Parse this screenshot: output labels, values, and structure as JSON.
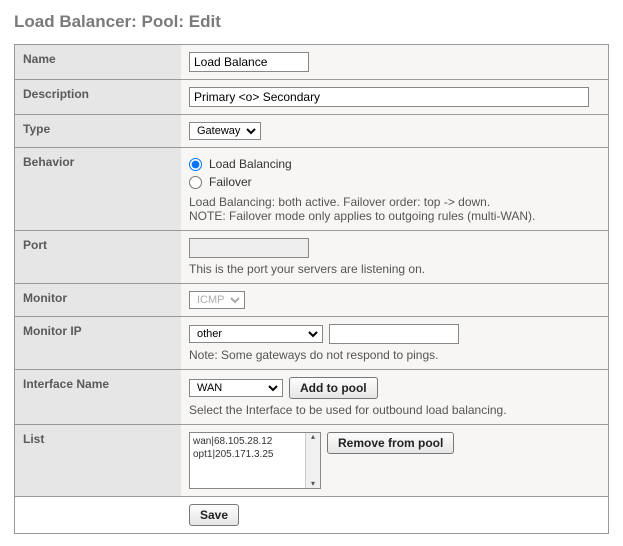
{
  "page_title": "Load Balancer: Pool: Edit",
  "rows": {
    "name": {
      "label": "Name",
      "value": "Load Balance"
    },
    "description": {
      "label": "Description",
      "value": "Primary <o> Secondary"
    },
    "type": {
      "label": "Type",
      "selected": "Gateway",
      "options": [
        "Gateway"
      ]
    },
    "behavior": {
      "label": "Behavior",
      "options": {
        "load_balancing": {
          "label": "Load Balancing",
          "checked": true
        },
        "failover": {
          "label": "Failover",
          "checked": false
        }
      },
      "help1": "Load Balancing: both active. Failover order: top -> down.",
      "help2": "NOTE: Failover mode only applies to outgoing rules (multi-WAN)."
    },
    "port": {
      "label": "Port",
      "value": "",
      "help": "This is the port your servers are listening on."
    },
    "monitor": {
      "label": "Monitor",
      "selected": "ICMP",
      "options": [
        "ICMP"
      ]
    },
    "monitor_ip": {
      "label": "Monitor IP",
      "selected": "other",
      "options": [
        "other"
      ],
      "value": "",
      "help": "Note: Some gateways do not respond to pings."
    },
    "interface_name": {
      "label": "Interface Name",
      "selected": "WAN",
      "options": [
        "WAN"
      ],
      "add_button": "Add to pool",
      "help": "Select the Interface to be used for outbound load balancing."
    },
    "list": {
      "label": "List",
      "items": [
        "wan|68.105.28.12",
        "opt1|205.171.3.25"
      ],
      "remove_button": "Remove from pool"
    }
  },
  "save_button": "Save"
}
